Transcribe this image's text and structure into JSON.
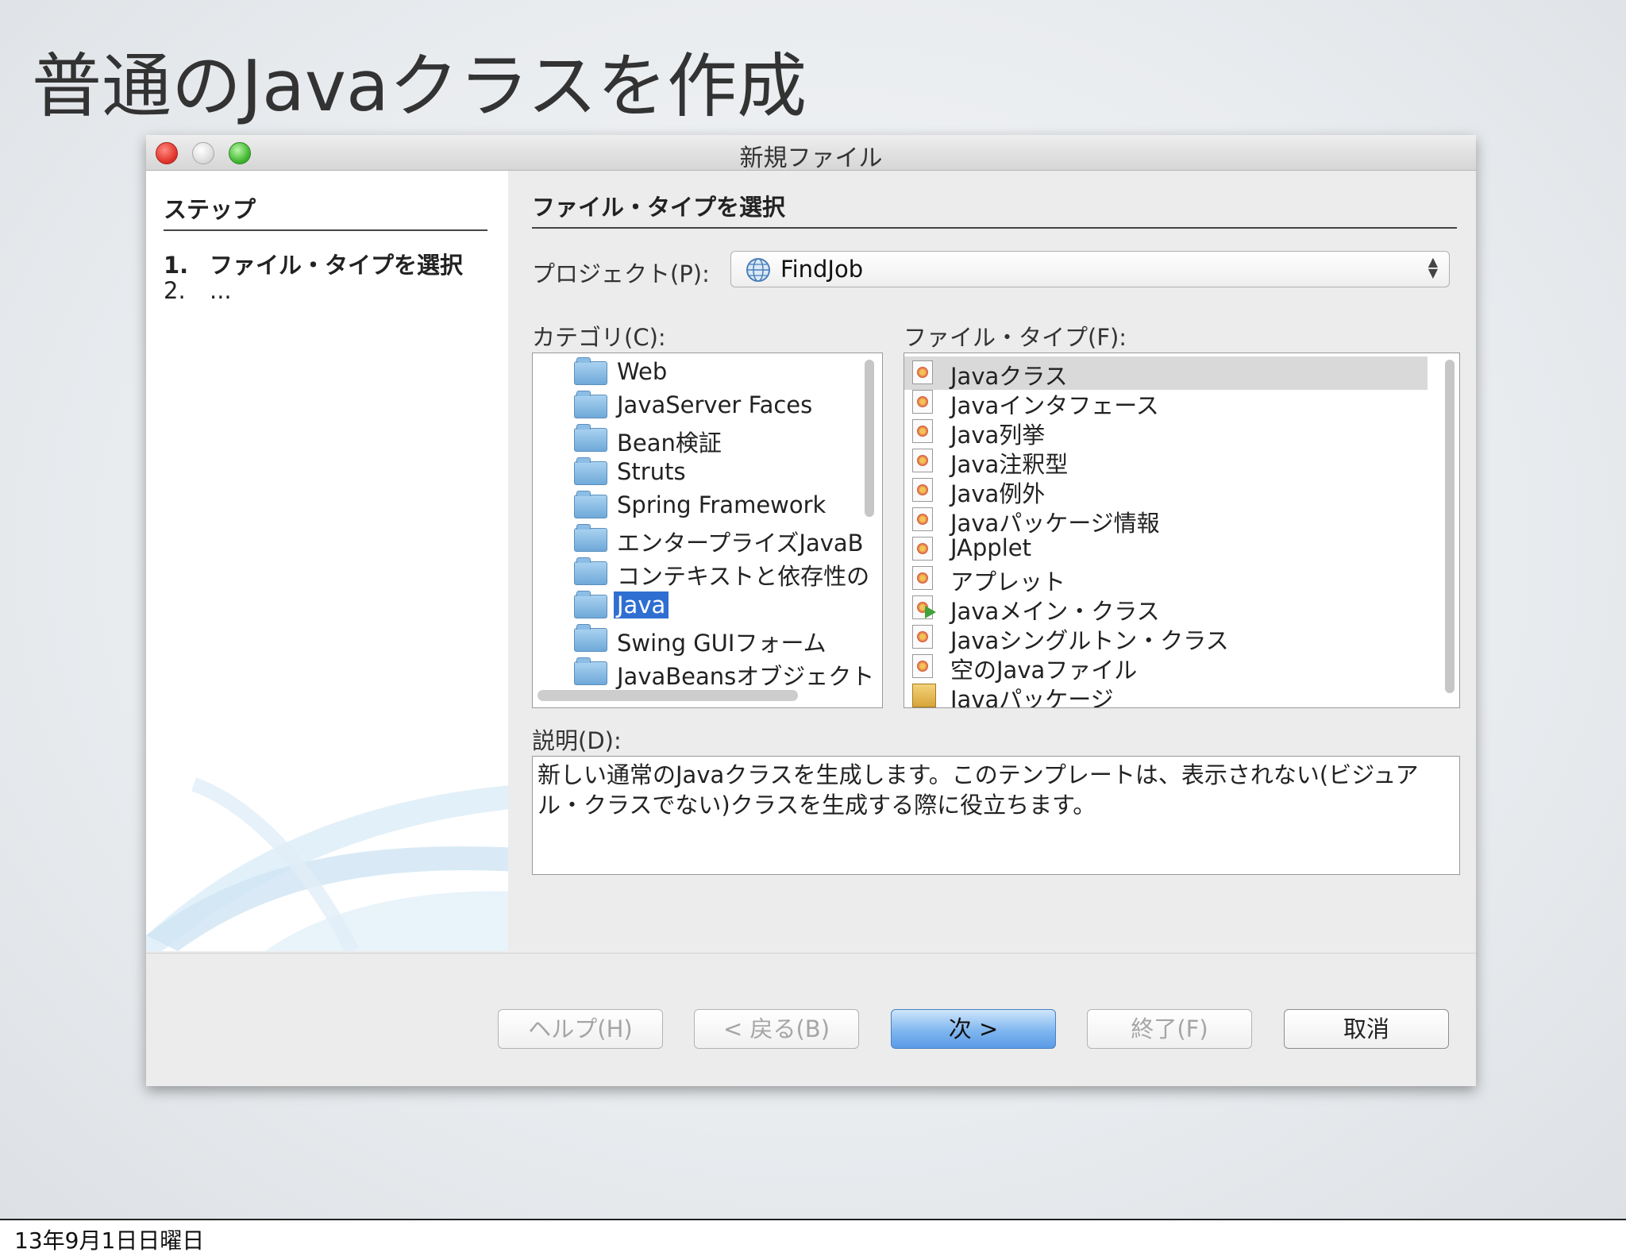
{
  "slide": {
    "title": "普通のJavaクラスを作成",
    "footer_date": "13年9月1日日曜日"
  },
  "dialog": {
    "title": "新規ファイル",
    "steps": {
      "heading": "ステップ",
      "items": [
        {
          "num": "1.",
          "label": "ファイル・タイプを選択"
        },
        {
          "num": "2.",
          "label": "..."
        }
      ]
    },
    "heading": "ファイル・タイプを選択",
    "project": {
      "label": "プロジェクト(P):",
      "value": "FindJob"
    },
    "categories": {
      "label": "カテゴリ(C):",
      "items": [
        "Web",
        "JavaServer Faces",
        "Bean検証",
        "Struts",
        "Spring Framework",
        "エンタープライズJavaB",
        "コンテキストと依存性の",
        "Java",
        "Swing GUIフォーム",
        "JavaBeansオブジェクト"
      ],
      "selected": "Java"
    },
    "file_types": {
      "label": "ファイル・タイプ(F):",
      "items": [
        "Javaクラス",
        "Javaインタフェース",
        "Java列挙",
        "Java注釈型",
        "Java例外",
        "Javaパッケージ情報",
        "JApplet",
        "アプレット",
        "Javaメイン・クラス",
        "Javaシングルトン・クラス",
        "空のJavaファイル",
        "Javaパッケージ"
      ],
      "selected": "Javaクラス"
    },
    "description": {
      "label": "説明(D):",
      "text": "新しい通常のJavaクラスを生成します。このテンプレートは、表示されない(ビジュアル・クラスでない)クラスを生成する際に役立ちます。"
    },
    "buttons": {
      "help": "ヘルプ(H)",
      "back": "< 戻る(B)",
      "next": "次 >",
      "finish": "終了(F)",
      "cancel": "取消"
    },
    "colors": {
      "selection": "#2f6fd1",
      "primary_button": "#7fb6ef"
    }
  }
}
